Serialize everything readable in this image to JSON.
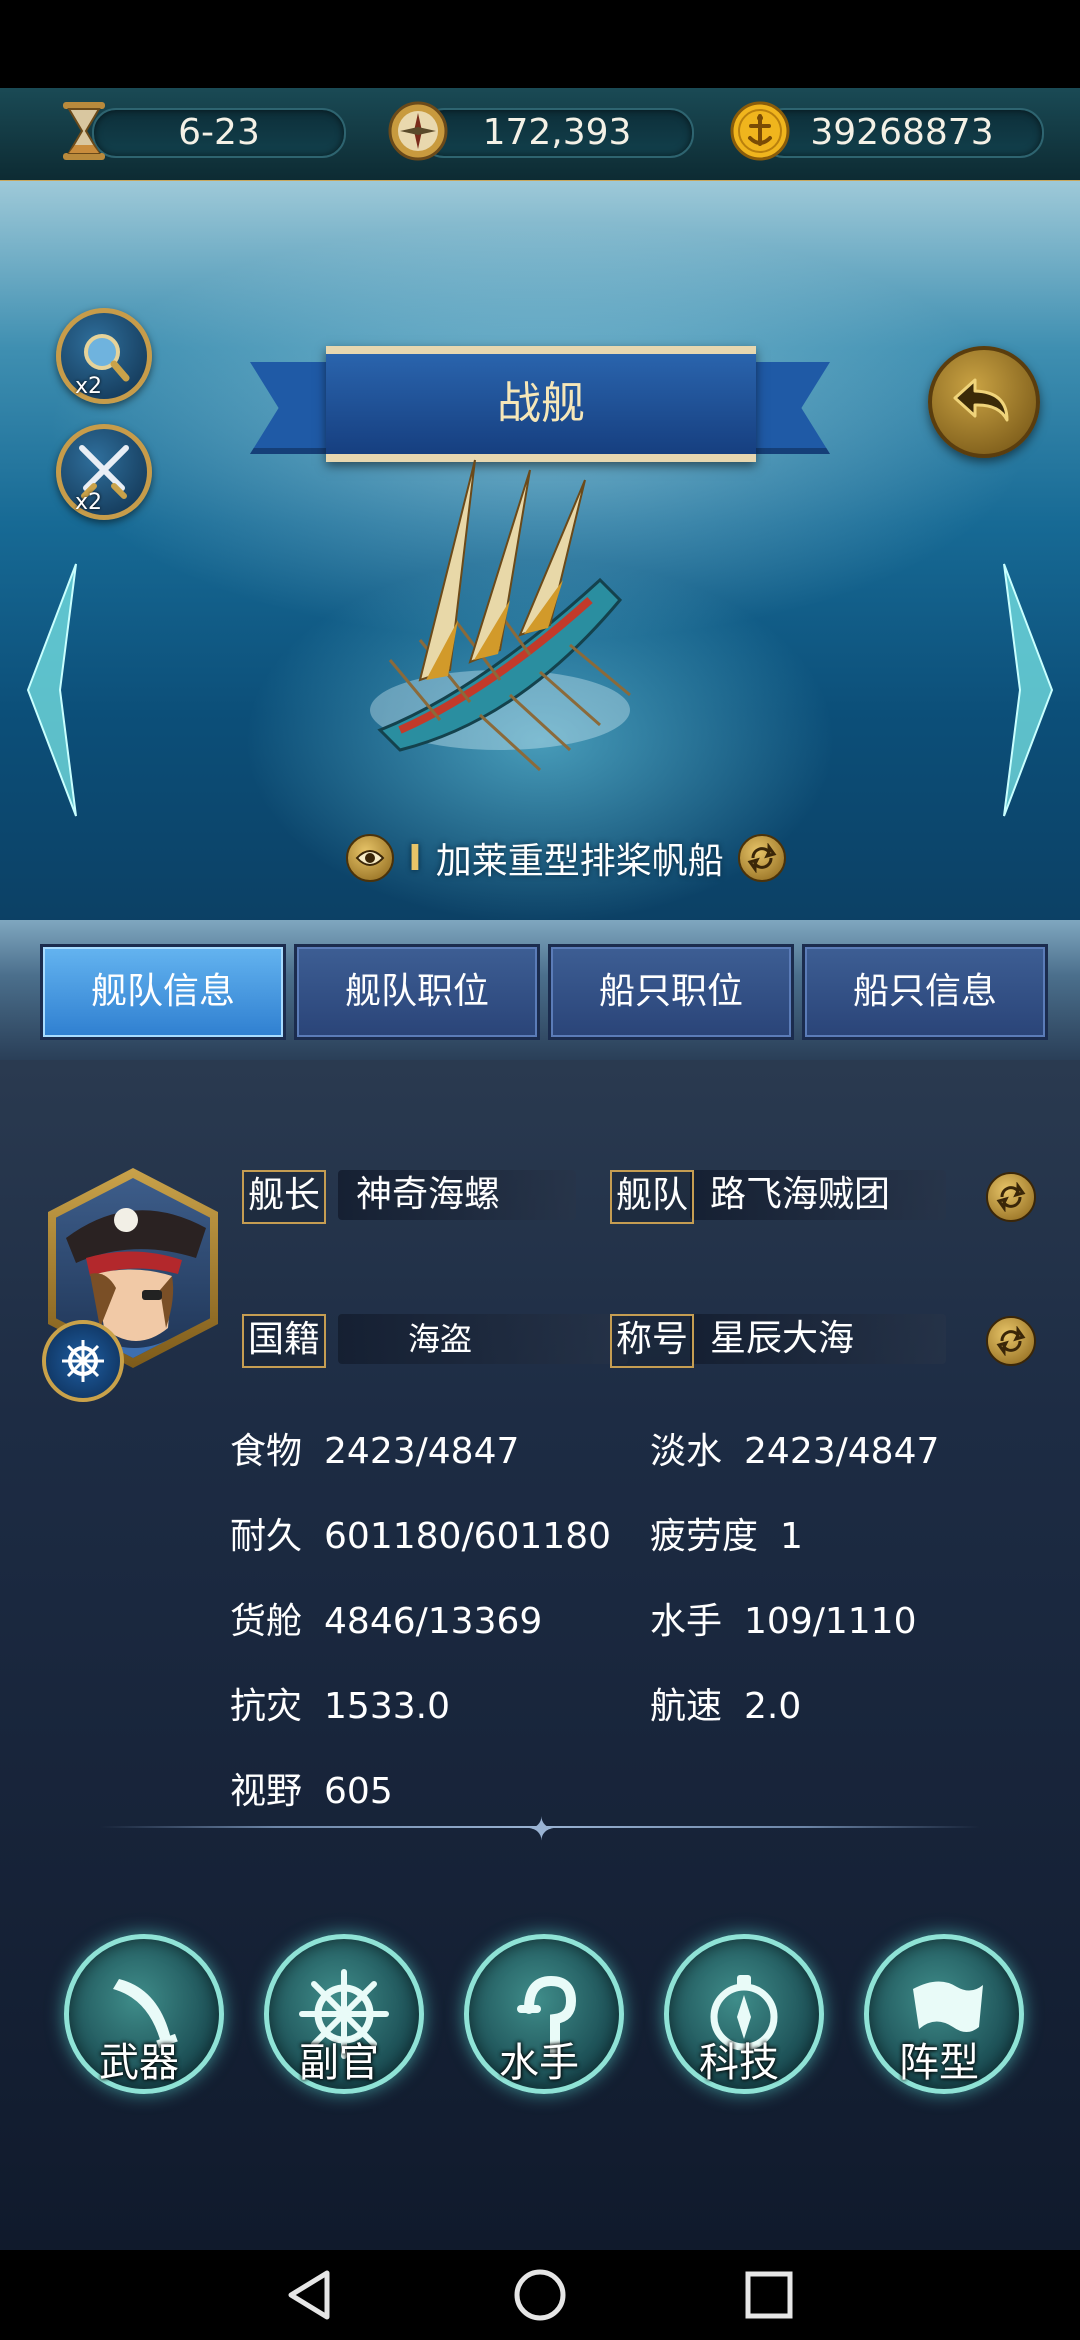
{
  "resources": {
    "time": "6-23",
    "compass_value": "172,393",
    "gold": "39268873"
  },
  "buffs": [
    {
      "icon": "magnifier-icon",
      "multiplier": "x2"
    },
    {
      "icon": "crossed-swords-icon",
      "multiplier": "x2"
    }
  ],
  "banner_title": "战舰",
  "ship": {
    "type_label": "I",
    "name": "加莱重型排桨帆船"
  },
  "tabs": [
    {
      "label": "舰队信息",
      "active": true
    },
    {
      "label": "舰队职位",
      "active": false
    },
    {
      "label": "船只职位",
      "active": false
    },
    {
      "label": "船只信息",
      "active": false
    }
  ],
  "fleet_info": {
    "captain_label": "舰长",
    "captain_value": "神奇海螺",
    "fleet_label": "舰队",
    "fleet_value": "路飞海贼团",
    "nationality_label": "国籍",
    "nationality_value": "海盗",
    "title_label": "称号",
    "title_value": "星辰大海"
  },
  "stats": {
    "food": {
      "label": "食物",
      "value": "2423/4847"
    },
    "water": {
      "label": "淡水",
      "value": "2423/4847"
    },
    "durability": {
      "label": "耐久",
      "value": "601180/601180"
    },
    "fatigue": {
      "label": "疲劳度",
      "value": "1"
    },
    "cargo": {
      "label": "货舱",
      "value": "4846/13369"
    },
    "sailors": {
      "label": "水手",
      "value": "109/1110"
    },
    "disaster_resist": {
      "label": "抗灾",
      "value": "1533.0"
    },
    "speed": {
      "label": "航速",
      "value": "2.0"
    },
    "vision": {
      "label": "视野",
      "value": "605"
    }
  },
  "actions": [
    {
      "label": "武器",
      "icon": "weapon-icon"
    },
    {
      "label": "副官",
      "icon": "ship-wheel-icon"
    },
    {
      "label": "水手",
      "icon": "hook-icon"
    },
    {
      "label": "科技",
      "icon": "compass-icon"
    },
    {
      "label": "阵型",
      "icon": "flag-icon"
    }
  ],
  "colors": {
    "gold": "#c9a24a",
    "tab_active": "#3f95e0",
    "tab_inactive": "#34548a",
    "action_glow": "#8fe3d6"
  }
}
